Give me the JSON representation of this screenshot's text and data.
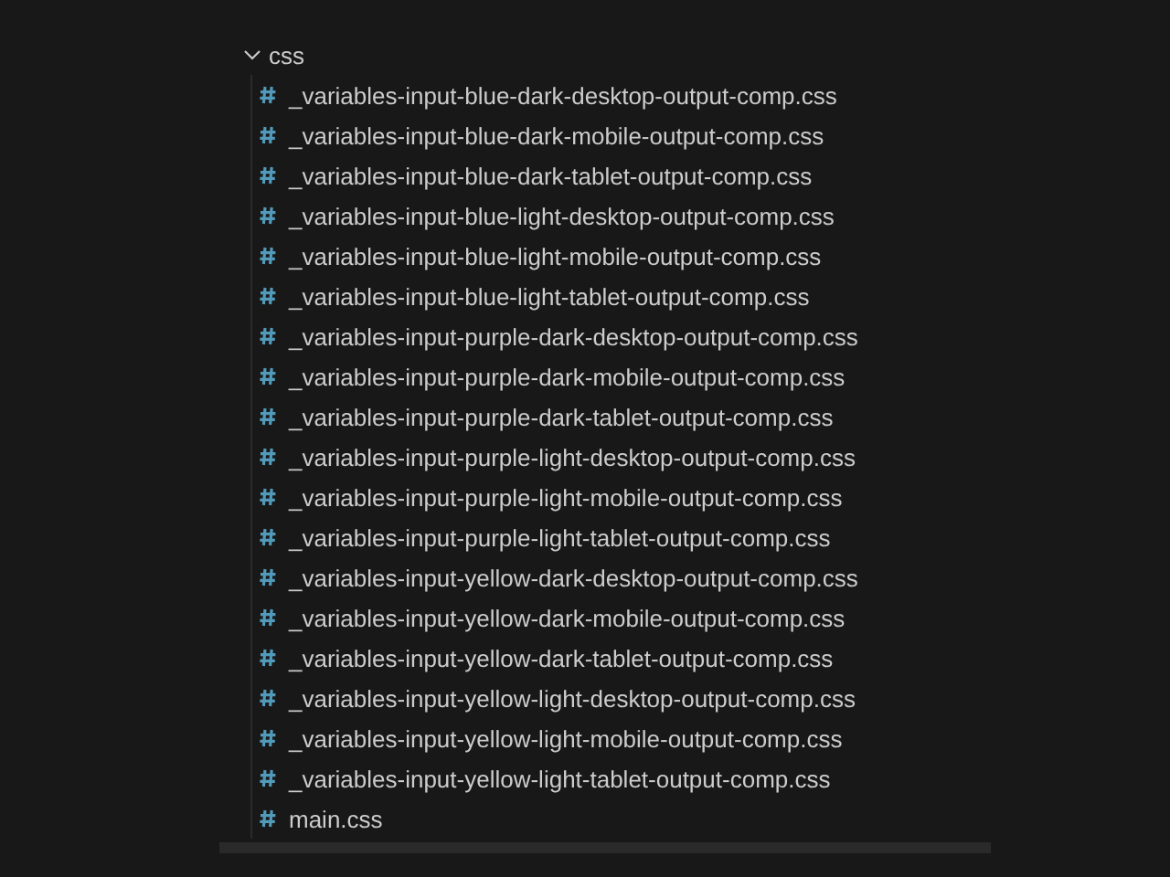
{
  "explorer": {
    "folder": {
      "name": "css",
      "expanded": true,
      "children": [
        {
          "name": "_variables-input-blue-dark-desktop-output-comp.css"
        },
        {
          "name": "_variables-input-blue-dark-mobile-output-comp.css"
        },
        {
          "name": "_variables-input-blue-dark-tablet-output-comp.css"
        },
        {
          "name": "_variables-input-blue-light-desktop-output-comp.css"
        },
        {
          "name": "_variables-input-blue-light-mobile-output-comp.css"
        },
        {
          "name": "_variables-input-blue-light-tablet-output-comp.css"
        },
        {
          "name": "_variables-input-purple-dark-desktop-output-comp.css"
        },
        {
          "name": "_variables-input-purple-dark-mobile-output-comp.css"
        },
        {
          "name": "_variables-input-purple-dark-tablet-output-comp.css"
        },
        {
          "name": "_variables-input-purple-light-desktop-output-comp.css"
        },
        {
          "name": "_variables-input-purple-light-mobile-output-comp.css"
        },
        {
          "name": "_variables-input-purple-light-tablet-output-comp.css"
        },
        {
          "name": "_variables-input-yellow-dark-desktop-output-comp.css"
        },
        {
          "name": "_variables-input-yellow-dark-mobile-output-comp.css"
        },
        {
          "name": "_variables-input-yellow-dark-tablet-output-comp.css"
        },
        {
          "name": "_variables-input-yellow-light-desktop-output-comp.css"
        },
        {
          "name": "_variables-input-yellow-light-mobile-output-comp.css"
        },
        {
          "name": "_variables-input-yellow-light-tablet-output-comp.css"
        },
        {
          "name": "main.css"
        }
      ]
    }
  }
}
